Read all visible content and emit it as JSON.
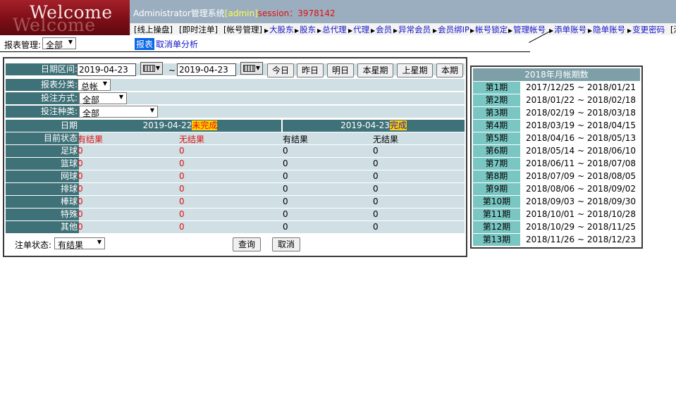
{
  "logo": {
    "text": "Welcome"
  },
  "topbar": {
    "system": "Administrator管理系统",
    "user": "[admin]",
    "session": "session：3978142"
  },
  "nav": [
    {
      "label": "[线上操盘]",
      "link": false
    },
    {
      "label": "[即时注单]",
      "link": false
    },
    {
      "label": "[帐号管理]",
      "link": false
    },
    {
      "label": "大股东",
      "link": true
    },
    {
      "label": "股东",
      "link": true
    },
    {
      "label": "总代理",
      "link": true
    },
    {
      "label": "代理",
      "link": true
    },
    {
      "label": "会员",
      "link": true
    },
    {
      "label": "异常会员",
      "link": true
    },
    {
      "label": "会员绑IP",
      "link": true
    },
    {
      "label": "帐号锁定",
      "link": true
    },
    {
      "label": "管理帐号",
      "link": true
    },
    {
      "label": "添单账号",
      "link": true
    },
    {
      "label": "隐单账号",
      "link": true
    },
    {
      "label": "变更密码",
      "link": true
    },
    {
      "label": "[清",
      "link": false
    }
  ],
  "subhead": {
    "report_mgmt_label": "报表管理:",
    "report_mgmt_value": "全部",
    "tab_active": "报表",
    "tab_link": "取消单分析"
  },
  "filters": {
    "date_range_label": "日期区间:",
    "date_from": "2019-04-23",
    "tilde": "~",
    "date_to": "2019-04-23",
    "quick_buttons": [
      "今日",
      "昨日",
      "明日",
      "本星期",
      "上星期",
      "本期"
    ],
    "report_class_label": "报表分类:",
    "report_class_value": "总帐",
    "bet_mode_label": "投注方式:",
    "bet_mode_value": "全部",
    "bet_type_label": "投注种类:",
    "bet_type_value": "全部"
  },
  "table": {
    "date_label": "日期",
    "status_label": "目前状态",
    "date1": "2019-04-22",
    "date1_status": "未完成",
    "date2": "2019-04-23",
    "date2_status": "完成",
    "sub_headers": [
      "有结果",
      "无结果",
      "有结果",
      "无结果"
    ],
    "rows": [
      {
        "sport": "足球",
        "values": [
          "0",
          "0",
          "0",
          "0"
        ]
      },
      {
        "sport": "篮球",
        "values": [
          "0",
          "0",
          "0",
          "0"
        ]
      },
      {
        "sport": "网球",
        "values": [
          "0",
          "0",
          "0",
          "0"
        ]
      },
      {
        "sport": "排球",
        "values": [
          "0",
          "0",
          "0",
          "0"
        ]
      },
      {
        "sport": "棒球",
        "values": [
          "0",
          "0",
          "0",
          "0"
        ]
      },
      {
        "sport": "特殊",
        "values": [
          "0",
          "0",
          "0",
          "0"
        ]
      },
      {
        "sport": "其他",
        "values": [
          "0",
          "0",
          "0",
          "0"
        ]
      }
    ]
  },
  "footer": {
    "order_status_label": "注单状态:",
    "order_status_value": "有结果",
    "query_button": "查询",
    "cancel_button": "取消"
  },
  "periods": {
    "title": "2018年月帐期数",
    "items": [
      {
        "name": "第1期",
        "range": "2017/12/25 ~ 2018/01/21"
      },
      {
        "name": "第2期",
        "range": "2018/01/22 ~ 2018/02/18"
      },
      {
        "name": "第3期",
        "range": "2018/02/19 ~ 2018/03/18"
      },
      {
        "name": "第4期",
        "range": "2018/03/19 ~ 2018/04/15"
      },
      {
        "name": "第5期",
        "range": "2018/04/16 ~ 2018/05/13"
      },
      {
        "name": "第6期",
        "range": "2018/05/14 ~ 2018/06/10"
      },
      {
        "name": "第7期",
        "range": "2018/06/11 ~ 2018/07/08"
      },
      {
        "name": "第8期",
        "range": "2018/07/09 ~ 2018/08/05"
      },
      {
        "name": "第9期",
        "range": "2018/08/06 ~ 2018/09/02"
      },
      {
        "name": "第10期",
        "range": "2018/09/03 ~ 2018/09/30"
      },
      {
        "name": "第11期",
        "range": "2018/10/01 ~ 2018/10/28"
      },
      {
        "name": "第12期",
        "range": "2018/10/29 ~ 2018/11/25"
      },
      {
        "name": "第13期",
        "range": "2018/11/26 ~ 2018/12/23"
      }
    ]
  }
}
